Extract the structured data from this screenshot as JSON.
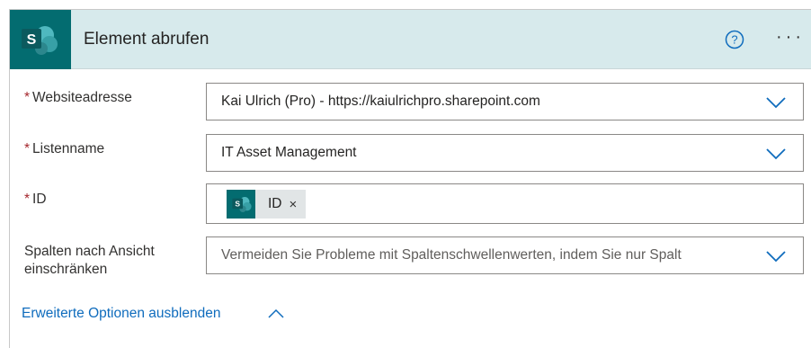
{
  "header": {
    "title": "Element abrufen",
    "logo_icon": "sharepoint-icon",
    "help_icon": "help-icon",
    "more_icon": "more-options-icon",
    "more_glyph": "···",
    "brand_color": "#036c70"
  },
  "fields": {
    "required_marker": "*",
    "website": {
      "label": "Websiteadresse",
      "value": "Kai Ulrich (Pro) - https://kaiulrichpro.sharepoint.com"
    },
    "list": {
      "label": "Listenname",
      "value": "IT Asset Management"
    },
    "id": {
      "label": "ID",
      "token_label": "ID",
      "token_close": "×"
    },
    "view": {
      "label": "Spalten nach Ansicht einschränken",
      "placeholder": "Vermeiden Sie Probleme mit Spaltenschwellenwerten, indem Sie nur Spalt"
    }
  },
  "advanced": {
    "link_label": "Erweiterte Optionen ausblenden"
  }
}
